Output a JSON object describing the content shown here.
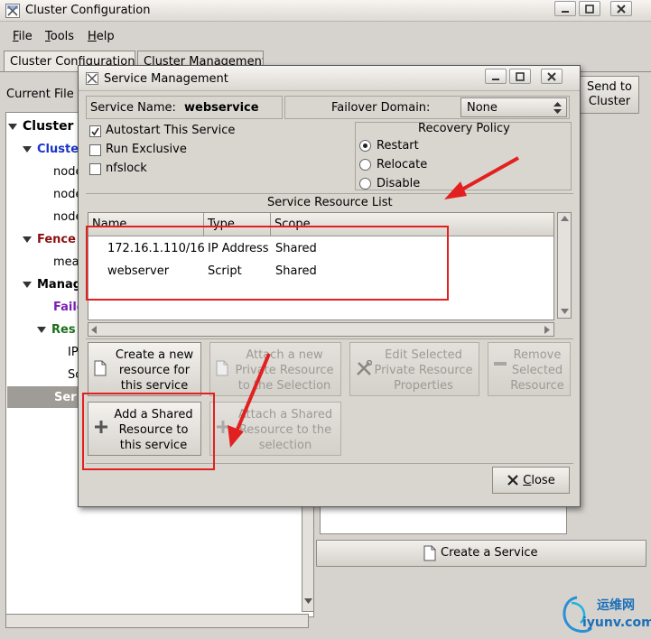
{
  "window": {
    "title": "Cluster Configuration"
  },
  "menu": [
    {
      "accel": "F",
      "rest": "ile"
    },
    {
      "accel": "T",
      "rest": "ools"
    },
    {
      "accel": "H",
      "rest": "elp"
    }
  ],
  "tabs": [
    "Cluster Configuration",
    "Cluster Management"
  ],
  "current_file_label": "Current File",
  "send_button": "Send to Cluster",
  "tree": [
    {
      "label": "Cluster",
      "color": "#000000"
    },
    {
      "label": "Cluste",
      "color": "#1a33c8"
    },
    {
      "label": "node",
      "color": "#000000"
    },
    {
      "label": "node",
      "color": "#000000"
    },
    {
      "label": "node",
      "color": "#000000"
    },
    {
      "label": "Fence",
      "color": "#8b1010"
    },
    {
      "label": "mea",
      "color": "#000000"
    },
    {
      "label": "Manag",
      "color": "#000000"
    },
    {
      "label": "Failo",
      "color": "#7a20b8"
    },
    {
      "label": "Res",
      "color": "#1a6e1a"
    },
    {
      "label": "IP",
      "color": "#000000"
    },
    {
      "label": "Sc",
      "color": "#000000"
    },
    {
      "label": "Ser",
      "color": "#ffffff"
    }
  ],
  "create_service_button": "Create a Service",
  "dialog": {
    "title": "Service Management",
    "service_name_label": "Service Name:",
    "service_name_value": "webservice",
    "failover_label": "Failover Domain:",
    "failover_value": "None",
    "checkboxes": [
      {
        "label": "Autostart This Service",
        "checked": true
      },
      {
        "label": "Run Exclusive",
        "checked": false
      },
      {
        "label": "nfslock",
        "checked": false
      }
    ],
    "recovery_title": "Recovery Policy",
    "recovery_options": [
      {
        "label": "Restart",
        "selected": true
      },
      {
        "label": "Relocate",
        "selected": false
      },
      {
        "label": "Disable",
        "selected": false
      }
    ],
    "resource_list_title": "Service Resource List",
    "columns": [
      "Name",
      "Type",
      "Scope"
    ],
    "rows": [
      [
        "172.16.1.110/16",
        "IP Address",
        "Shared"
      ],
      [
        "webserver",
        "Script",
        "Shared"
      ]
    ],
    "buttons": {
      "create_new": "Create a new resource for this service",
      "attach_private": "Attach a new Private Resource to the Selection",
      "edit_private": "Edit Selected Private Resource Properties",
      "remove_selected": "Remove Selected Resource",
      "add_shared": "Add a Shared Resource to this service",
      "attach_shared": "Attach a Shared Resource to the selection",
      "close_accel": "C",
      "close_rest": "lose"
    }
  },
  "watermark": {
    "cn": "运维网",
    "url": "iyunv.com"
  },
  "colors": {
    "annotation": "#e32020",
    "window_bg": "#d6d3ce"
  }
}
